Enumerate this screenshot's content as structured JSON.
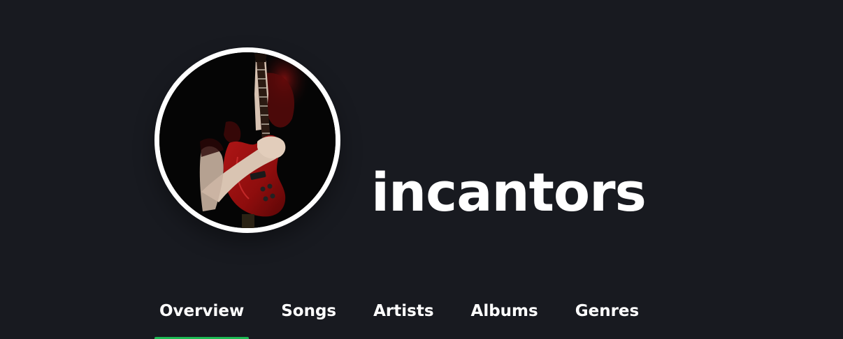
{
  "profile": {
    "username": "incantors",
    "avatar_icon": "guitarist-photo"
  },
  "tabs": [
    {
      "label": "Overview",
      "active": true
    },
    {
      "label": "Songs",
      "active": false
    },
    {
      "label": "Artists",
      "active": false
    },
    {
      "label": "Albums",
      "active": false
    },
    {
      "label": "Genres",
      "active": false
    }
  ],
  "colors": {
    "background": "#181a20",
    "text": "#ffffff",
    "accent": "#1db954",
    "avatar_border": "#ffffff"
  }
}
